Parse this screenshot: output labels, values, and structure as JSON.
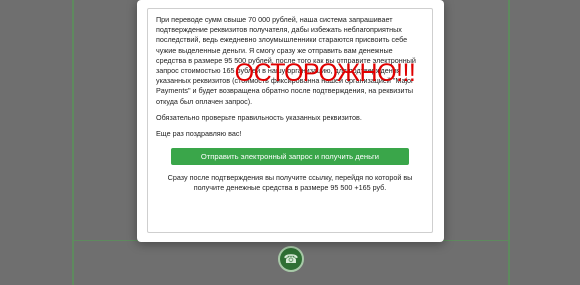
{
  "modal": {
    "paragraphs": [
      "При переводе сумм свыше 70 000 рублей, наша система запрашивает подтверждение реквизитов получателя, дабы избежать неблагоприятных последствий, ведь ежедневно злоумышленники стараются присвоить себе чужие выделенные деньги. Я смогу сразу же отправить вам денежные средства в размере 95 500 рублей, после того как вы отправите электронный запрос стоимостью 165 рублей в нашу организацию, для подтверждения указанных реквизитов (стоимость фиксированна нашей организацией \"Major Payments\" и будет возвращена обратно после подтверждения, на реквизиты откуда был оплачен запрос).",
      "Обязательно проверьте правильность указанных реквизитов.",
      "Еще раз поздравляю вас!"
    ],
    "button_label": "Отправить электронный запрос и получить деньги",
    "after_text": "Сразу после подтверждения вы получите ссылку, перейдя по которой вы получите денежные средства в размере 95 500 +165 руб."
  },
  "overlay": {
    "warning_text": "ОСТОРОЖНО!!!",
    "color": "#e00000"
  },
  "colors": {
    "button": "#3aa64a",
    "backdrop": "#6f6f6f"
  },
  "icons": {
    "background": "phone-icon"
  }
}
